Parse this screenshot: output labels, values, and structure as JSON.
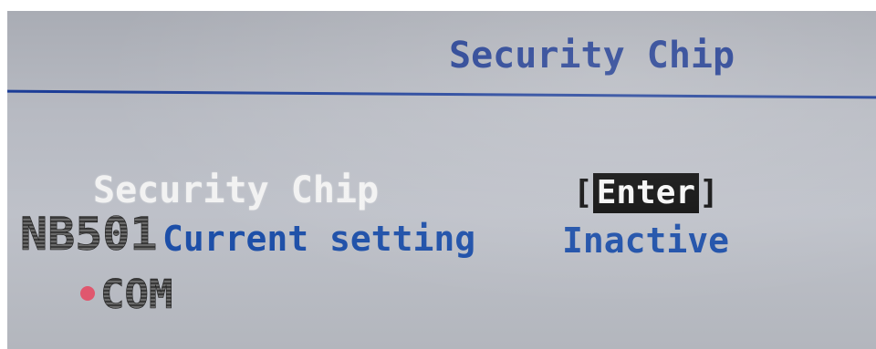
{
  "header": {
    "title": "Security Chip"
  },
  "menu": {
    "item_label": "Security Chip",
    "item_value_open": "[",
    "item_value": "Enter",
    "item_value_close": "]",
    "current_label": "Current setting",
    "current_value": "Inactive"
  },
  "watermark": {
    "line1": "NB501",
    "line2": "COM"
  },
  "colors": {
    "title_blue": "#1e3a8f",
    "setting_blue": "#1d4fa8",
    "background": "#b7bac2"
  }
}
